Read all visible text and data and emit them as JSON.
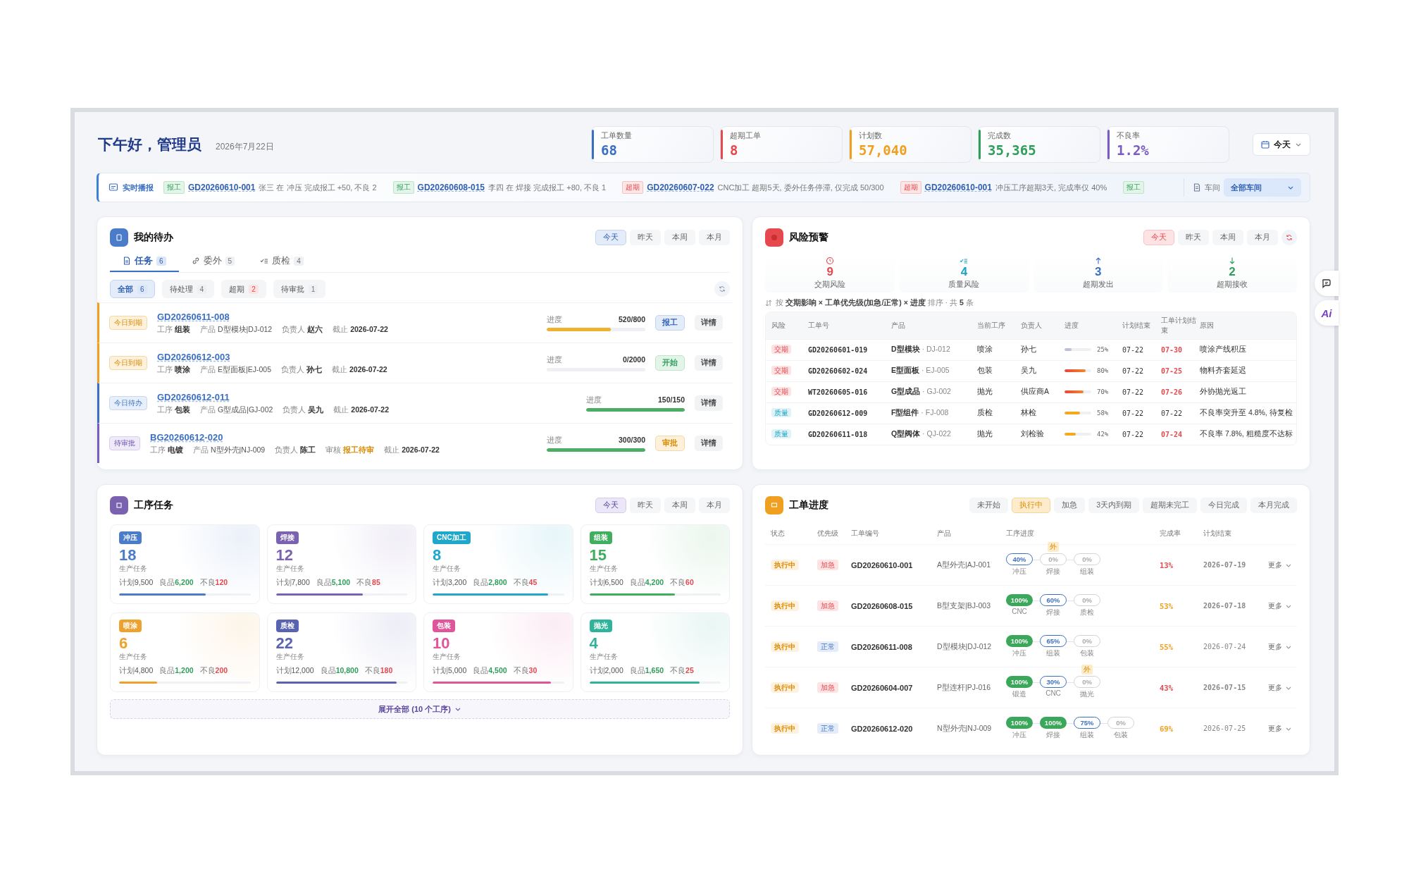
{
  "header": {
    "greeting": "下午好，管理员",
    "date": "2026年7月22日",
    "kpis": [
      {
        "label": "工单数量",
        "value": "68",
        "color": "#3b6fc4"
      },
      {
        "label": "超期工单",
        "value": "8",
        "color": "#e5484d"
      },
      {
        "label": "计划数",
        "value": "57,040",
        "color": "#f0a020"
      },
      {
        "label": "完成数",
        "value": "35,365",
        "color": "#2f9e5b"
      },
      {
        "label": "不良率",
        "value": "1.2%",
        "color": "#7b5cc4"
      }
    ],
    "date_select": "今天"
  },
  "ticker": {
    "title": "实时播报",
    "items": [
      {
        "tag": "报工",
        "kind": "report",
        "order": "GD20260610-001",
        "text": "张三 在 冲压 完成报工 +50, 不良 2"
      },
      {
        "tag": "报工",
        "kind": "report",
        "order": "GD20260608-015",
        "text": "李四 在 焊接 完成报工 +80, 不良 1"
      },
      {
        "tag": "超期",
        "kind": "overdue",
        "order": "GD20260607-022",
        "text": "CNC加工 超期5天, 委外任务停滞, 仅完成 50/300"
      },
      {
        "tag": "超期",
        "kind": "overdue",
        "order": "GD20260610-001",
        "text": "冲压工序超期3天, 完成率仅 40%"
      },
      {
        "tag": "报工",
        "kind": "report"
      }
    ],
    "workshop_label": "车间",
    "workshop_value": "全部车间"
  },
  "todo": {
    "title": "我的待办",
    "periods": [
      {
        "label": "今天",
        "selected": true
      },
      {
        "label": "昨天",
        "selected": false
      },
      {
        "label": "本周",
        "selected": false
      },
      {
        "label": "本月",
        "selected": false
      }
    ],
    "tabs": [
      {
        "label": "任务",
        "count": "6",
        "kind": "task",
        "selected": true
      },
      {
        "label": "委外",
        "count": "5",
        "kind": "outsource",
        "selected": false
      },
      {
        "label": "质检",
        "count": "4",
        "kind": "quality",
        "selected": false
      }
    ],
    "filters": [
      {
        "label": "全部",
        "count": "6",
        "kind": "normal",
        "selected": true
      },
      {
        "label": "待处理",
        "count": "4",
        "kind": "normal",
        "selected": false
      },
      {
        "label": "超期",
        "count": "2",
        "kind": "alert",
        "selected": false
      },
      {
        "label": "待审批",
        "count": "1",
        "kind": "normal",
        "selected": false
      }
    ],
    "items": [
      {
        "tag": "今日到期",
        "kind": "due",
        "order": "GD20260611-008",
        "fields": [
          {
            "label": "工序",
            "value": "组装",
            "kind": "strong"
          },
          {
            "label": "产品",
            "value": "D型模块|DJ-012",
            "kind": "plain"
          },
          {
            "label": "负责人",
            "value": "赵六",
            "kind": "strong"
          },
          {
            "label": "截止",
            "value": "2026-07-22",
            "kind": "strong"
          }
        ],
        "progress_label": "进度",
        "reading": "520/800",
        "level": 0.65,
        "action": {
          "label": "报工",
          "kind": "report"
        },
        "details": "详情"
      },
      {
        "tag": "今日到期",
        "kind": "due",
        "order": "GD20260612-003",
        "fields": [
          {
            "label": "工序",
            "value": "喷涂",
            "kind": "strong"
          },
          {
            "label": "产品",
            "value": "E型面板|EJ-005",
            "kind": "plain"
          },
          {
            "label": "负责人",
            "value": "孙七",
            "kind": "strong"
          },
          {
            "label": "截止",
            "value": "2026-07-22",
            "kind": "strong"
          }
        ],
        "progress_label": "进度",
        "reading": "0/2000",
        "action": {
          "label": "开始",
          "kind": "start"
        },
        "details": "详情"
      },
      {
        "tag": "今日待办",
        "kind": "todo",
        "order": "GD20260612-011",
        "fields": [
          {
            "label": "工序",
            "value": "包装",
            "kind": "strong"
          },
          {
            "label": "产品",
            "value": "G型成品|GJ-002",
            "kind": "plain"
          },
          {
            "label": "负责人",
            "value": "吴九",
            "kind": "strong"
          },
          {
            "label": "截止",
            "value": "2026-07-22",
            "kind": "strong"
          }
        ],
        "progress_label": "进度",
        "reading": "150/150",
        "level": 1,
        "details": "详情"
      },
      {
        "tag": "待审批",
        "kind": "approve",
        "order": "BG20260612-020",
        "fields": [
          {
            "label": "工序",
            "value": "电镀",
            "kind": "strong"
          },
          {
            "label": "产品",
            "value": "N型外壳|NJ-009",
            "kind": "plain"
          },
          {
            "label": "负责人",
            "value": "陈工",
            "kind": "strong"
          },
          {
            "label": "审核",
            "value": "报工待审",
            "kind": "warn"
          },
          {
            "label": "截止",
            "value": "2026-07-22",
            "kind": "strong"
          }
        ],
        "progress_label": "进度",
        "reading": "300/300",
        "level": 1,
        "action": {
          "label": "审批",
          "kind": "approve"
        },
        "details": "详情"
      }
    ]
  },
  "risk": {
    "title": "风险预警",
    "periods": [
      {
        "label": "今天",
        "selected": true
      },
      {
        "label": "昨天",
        "selected": false
      },
      {
        "label": "本周",
        "selected": false
      },
      {
        "label": "本月",
        "selected": false
      }
    ],
    "stats": [
      {
        "value": "9",
        "label": "交期风险",
        "kind": "delivery"
      },
      {
        "value": "4",
        "label": "质量风险",
        "kind": "quality"
      },
      {
        "value": "3",
        "label": "超期发出",
        "kind": "out"
      },
      {
        "value": "2",
        "label": "超期接收",
        "kind": "in"
      }
    ],
    "sort_note": "按 **交期影响 × 工单优先级(加急/正常) × 进度** 排序 · 共 **5** 条",
    "columns": [
      "风险",
      "工单号",
      "产品",
      "当前工序",
      "负责人",
      "进度",
      "计划结束",
      "工单计划结束",
      "原因"
    ],
    "rows": [
      {
        "risk": "交期",
        "kind": "delivery",
        "order": "GD20260601-019",
        "product": "D型模块",
        "code": "· DJ-012",
        "process": "喷涂",
        "owner": "孙七",
        "level": 0.25,
        "reading": "25%",
        "plan_end": "07-22",
        "order_end": "07-30",
        "late": true,
        "reason": "喷涂产线积压"
      },
      {
        "risk": "交期",
        "kind": "delivery",
        "order": "GD20260602-024",
        "product": "E型面板",
        "code": "· EJ-005",
        "process": "包装",
        "owner": "吴九",
        "level": 0.8,
        "reading": "80%",
        "plan_end": "07-22",
        "order_end": "07-25",
        "late": true,
        "reason": "物料齐套延迟"
      },
      {
        "risk": "交期",
        "kind": "delivery",
        "order": "WT20260605-016",
        "product": "G型成品",
        "code": "· GJ-002",
        "process": "抛光",
        "owner": "供应商A",
        "level": 0.7,
        "reading": "70%",
        "plan_end": "07-22",
        "order_end": "07-26",
        "late": true,
        "reason": "外协抛光返工"
      },
      {
        "risk": "质量",
        "kind": "quality",
        "order": "GD20260612-009",
        "product": "F型组件",
        "code": "· FJ-008",
        "process": "质检",
        "owner": "林检",
        "level": 0.58,
        "reading": "58%",
        "plan_end": "07-22",
        "order_end": "07-22",
        "late": false,
        "reason": "不良率突升至 4.8%, 待复检"
      },
      {
        "risk": "质量",
        "kind": "quality",
        "order": "GD20260611-018",
        "product": "Q型阀体",
        "code": "· QJ-022",
        "process": "抛光",
        "owner": "刘检验",
        "level": 0.42,
        "reading": "42%",
        "plan_end": "07-22",
        "order_end": "07-24",
        "late": true,
        "reason": "不良率 7.8%, 粗糙度不达标"
      }
    ]
  },
  "process_tasks": {
    "title": "工序任务",
    "periods": [
      {
        "label": "今天",
        "selected": true
      },
      {
        "label": "昨天",
        "selected": false
      },
      {
        "label": "本周",
        "selected": false
      },
      {
        "label": "本月",
        "selected": false
      }
    ],
    "cards": [
      {
        "tag": "冲压",
        "color": "#4a7cc9",
        "count": "18",
        "caption": "生产任务",
        "stats": [
          {
            "label": "计划",
            "value": "9,500",
            "kind": "plan"
          },
          {
            "label": "良品",
            "value": "6,200",
            "kind": "good"
          },
          {
            "label": "不良",
            "value": "120",
            "kind": "bad"
          }
        ],
        "level": 0.66
      },
      {
        "tag": "焊接",
        "color": "#7b62b0",
        "count": "12",
        "caption": "生产任务",
        "stats": [
          {
            "label": "计划",
            "value": "7,800",
            "kind": "plan"
          },
          {
            "label": "良品",
            "value": "5,100",
            "kind": "good"
          },
          {
            "label": "不良",
            "value": "85",
            "kind": "bad"
          }
        ],
        "level": 0.66
      },
      {
        "tag": "CNC加工",
        "color": "#1fa8c9",
        "count": "8",
        "caption": "生产任务",
        "stats": [
          {
            "label": "计划",
            "value": "3,200",
            "kind": "plan"
          },
          {
            "label": "良品",
            "value": "2,800",
            "kind": "good"
          },
          {
            "label": "不良",
            "value": "45",
            "kind": "bad"
          }
        ],
        "level": 0.88
      },
      {
        "tag": "组装",
        "color": "#3fae5e",
        "count": "15",
        "caption": "生产任务",
        "stats": [
          {
            "label": "计划",
            "value": "6,500",
            "kind": "plan"
          },
          {
            "label": "良品",
            "value": "4,200",
            "kind": "good"
          },
          {
            "label": "不良",
            "value": "60",
            "kind": "bad"
          }
        ],
        "level": 0.65
      },
      {
        "tag": "喷涂",
        "color": "#eda22e",
        "count": "6",
        "caption": "生产任务",
        "stats": [
          {
            "label": "计划",
            "value": "4,800",
            "kind": "plan"
          },
          {
            "label": "良品",
            "value": "1,200",
            "kind": "good"
          },
          {
            "label": "不良",
            "value": "200",
            "kind": "bad"
          }
        ],
        "level": 0.29
      },
      {
        "tag": "质检",
        "color": "#5a63b0",
        "count": "22",
        "caption": "生产任务",
        "stats": [
          {
            "label": "计划",
            "value": "12,000",
            "kind": "plan"
          },
          {
            "label": "良品",
            "value": "10,800",
            "kind": "good"
          },
          {
            "label": "不良",
            "value": "180",
            "kind": "bad"
          }
        ],
        "level": 0.92
      },
      {
        "tag": "包装",
        "color": "#e0559a",
        "count": "10",
        "caption": "生产任务",
        "stats": [
          {
            "label": "计划",
            "value": "5,000",
            "kind": "plan"
          },
          {
            "label": "良品",
            "value": "4,500",
            "kind": "good"
          },
          {
            "label": "不良",
            "value": "30",
            "kind": "bad"
          }
        ],
        "level": 0.9
      },
      {
        "tag": "抛光",
        "color": "#2fb39a",
        "count": "4",
        "caption": "生产任务",
        "stats": [
          {
            "label": "计划",
            "value": "2,000",
            "kind": "plan"
          },
          {
            "label": "良品",
            "value": "1,650",
            "kind": "good"
          },
          {
            "label": "不良",
            "value": "25",
            "kind": "bad"
          }
        ],
        "level": 0.84
      }
    ],
    "expand": "展开全部 (10 个工序)"
  },
  "work_orders": {
    "title": "工单进度",
    "filters": [
      {
        "label": "未开始",
        "selected": false
      },
      {
        "label": "执行中",
        "selected": true
      },
      {
        "label": "加急",
        "selected": false
      },
      {
        "label": "3天内到期",
        "selected": false
      },
      {
        "label": "超期未完工",
        "selected": false
      },
      {
        "label": "今日完成",
        "selected": false
      },
      {
        "label": "本月完成",
        "selected": false
      }
    ],
    "columns": [
      "状态",
      "优先级",
      "工单编号",
      "产品",
      "工序进度",
      "完成率",
      "计划结束"
    ],
    "rows": [
      {
        "status": "执行中",
        "priority": "加急",
        "urgent": true,
        "order": "GD20260610-001",
        "product": "A型外壳|AJ-001",
        "steps": [
          {
            "pct": "40%",
            "name": "冲压",
            "kind": "active"
          },
          {
            "pct": "0%",
            "name": "焊接",
            "kind": "todo",
            "badge": "外"
          },
          {
            "pct": "0%",
            "name": "组装",
            "kind": "todo"
          }
        ],
        "rate": "13%",
        "rate_alert": true,
        "end": "2026-07-19",
        "late": true,
        "more": "更多"
      },
      {
        "status": "执行中",
        "priority": "加急",
        "urgent": true,
        "order": "GD20260608-015",
        "product": "B型支架|BJ-003",
        "steps": [
          {
            "pct": "100%",
            "name": "CNC",
            "kind": "done"
          },
          {
            "pct": "60%",
            "name": "焊接",
            "kind": "active"
          },
          {
            "pct": "0%",
            "name": "质检",
            "kind": "todo"
          }
        ],
        "rate": "53%",
        "rate_alert": false,
        "end": "2026-07-18",
        "late": true,
        "more": "更多"
      },
      {
        "status": "执行中",
        "priority": "正常",
        "urgent": false,
        "order": "GD20260611-008",
        "product": "D型模块|DJ-012",
        "steps": [
          {
            "pct": "100%",
            "name": "冲压",
            "kind": "done"
          },
          {
            "pct": "65%",
            "name": "组装",
            "kind": "active"
          },
          {
            "pct": "0%",
            "name": "包装",
            "kind": "todo"
          }
        ],
        "rate": "55%",
        "rate_alert": false,
        "end": "2026-07-24",
        "late": false,
        "more": "更多"
      },
      {
        "status": "执行中",
        "priority": "加急",
        "urgent": true,
        "order": "GD20260604-007",
        "product": "P型连杆|PJ-016",
        "steps": [
          {
            "pct": "100%",
            "name": "锻造",
            "kind": "done"
          },
          {
            "pct": "30%",
            "name": "CNC",
            "kind": "active"
          },
          {
            "pct": "0%",
            "name": "抛光",
            "kind": "todo",
            "badge": "外"
          }
        ],
        "rate": "43%",
        "rate_alert": true,
        "end": "2026-07-15",
        "late": true,
        "more": "更多"
      },
      {
        "status": "执行中",
        "priority": "正常",
        "urgent": false,
        "order": "GD20260612-020",
        "product": "N型外壳|NJ-009",
        "steps": [
          {
            "pct": "100%",
            "name": "冲压",
            "kind": "done"
          },
          {
            "pct": "100%",
            "name": "焊接",
            "kind": "done"
          },
          {
            "pct": "75%",
            "name": "组装",
            "kind": "active"
          },
          {
            "pct": "0%",
            "name": "包装",
            "kind": "todo"
          }
        ],
        "rate": "69%",
        "rate_alert": false,
        "end": "2026-07-25",
        "late": false,
        "more": "更多"
      }
    ]
  },
  "side_buttons": [
    {
      "kind": "chat"
    },
    {
      "kind": "ai",
      "label": "Ai"
    }
  ]
}
